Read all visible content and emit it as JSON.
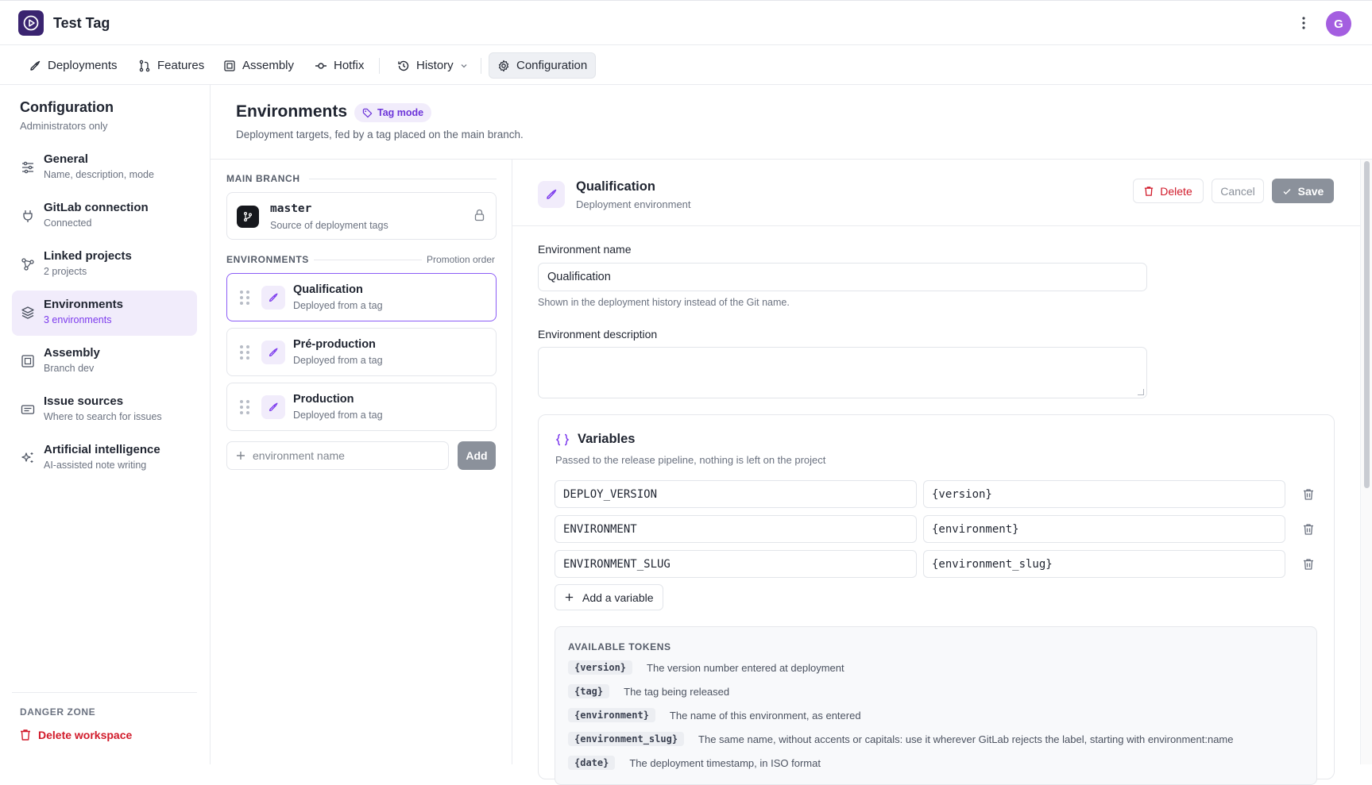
{
  "app": {
    "title": "Test Tag",
    "avatar_initial": "G"
  },
  "nav": {
    "items": [
      {
        "label": "Deployments",
        "icon": "rocket-icon"
      },
      {
        "label": "Features",
        "icon": "merge-icon"
      },
      {
        "label": "Assembly",
        "icon": "frame-icon"
      },
      {
        "label": "Hotfix",
        "icon": "commit-icon"
      },
      {
        "label": "History",
        "icon": "history-icon"
      },
      {
        "label": "Configuration",
        "icon": "gear-icon",
        "active": true
      }
    ]
  },
  "sidebar": {
    "title": "Configuration",
    "subtitle": "Administrators only",
    "items": [
      {
        "label": "General",
        "desc": "Name, description, mode"
      },
      {
        "label": "GitLab connection",
        "desc": "Connected"
      },
      {
        "label": "Linked projects",
        "desc": "2 projects"
      },
      {
        "label": "Environments",
        "desc": "3 environments",
        "active": true
      },
      {
        "label": "Assembly",
        "desc": "Branch dev"
      },
      {
        "label": "Issue sources",
        "desc": "Where to search for issues"
      },
      {
        "label": "Artificial intelligence",
        "desc": "AI-assisted note writing"
      }
    ],
    "danger_zone_label": "DANGER ZONE",
    "delete_workspace": "Delete workspace"
  },
  "page": {
    "title": "Environments",
    "badge": "Tag mode",
    "subtitle": "Deployment targets, fed by a tag placed on the main branch."
  },
  "main_branch": {
    "section_label": "MAIN BRANCH",
    "name": "master",
    "desc": "Source of deployment tags"
  },
  "environments": {
    "section_label": "ENVIRONMENTS",
    "order_label": "Promotion order",
    "items": [
      {
        "name": "Qualification",
        "desc": "Deployed from a tag"
      },
      {
        "name": "Pré-production",
        "desc": "Deployed from a tag"
      },
      {
        "name": "Production",
        "desc": "Deployed from a tag"
      }
    ],
    "new_placeholder": "environment name",
    "add_label": "Add"
  },
  "detail": {
    "title": "Qualification",
    "subtitle": "Deployment environment",
    "delete_label": "Delete",
    "cancel_label": "Cancel",
    "save_label": "Save",
    "name_label": "Environment name",
    "name_value": "Qualification",
    "name_hint": "Shown in the deployment history instead of the Git name.",
    "description_label": "Environment description",
    "description_value": ""
  },
  "variables": {
    "title": "Variables",
    "subtitle": "Passed to the release pipeline, nothing is left on the project",
    "rows": [
      {
        "key": "DEPLOY_VERSION",
        "value": "{version}"
      },
      {
        "key": "ENVIRONMENT",
        "value": "{environment}"
      },
      {
        "key": "ENVIRONMENT_SLUG",
        "value": "{environment_slug}"
      }
    ],
    "add_label": "Add a variable"
  },
  "tokens": {
    "heading": "AVAILABLE TOKENS",
    "items": [
      {
        "code": "{version}",
        "desc": "The version number entered at deployment"
      },
      {
        "code": "{tag}",
        "desc": "The tag being released"
      },
      {
        "code": "{environment}",
        "desc": "The name of this environment, as entered"
      },
      {
        "code": "{environment_slug}",
        "desc": "The same name, without accents or capitals: use it wherever GitLab rejects the label, starting with environment:name"
      },
      {
        "code": "{date}",
        "desc": "The deployment timestamp, in ISO format"
      }
    ]
  },
  "colors": {
    "accent": "#7c3aed",
    "danger": "#d11a2a",
    "brand": "#3a2470"
  }
}
